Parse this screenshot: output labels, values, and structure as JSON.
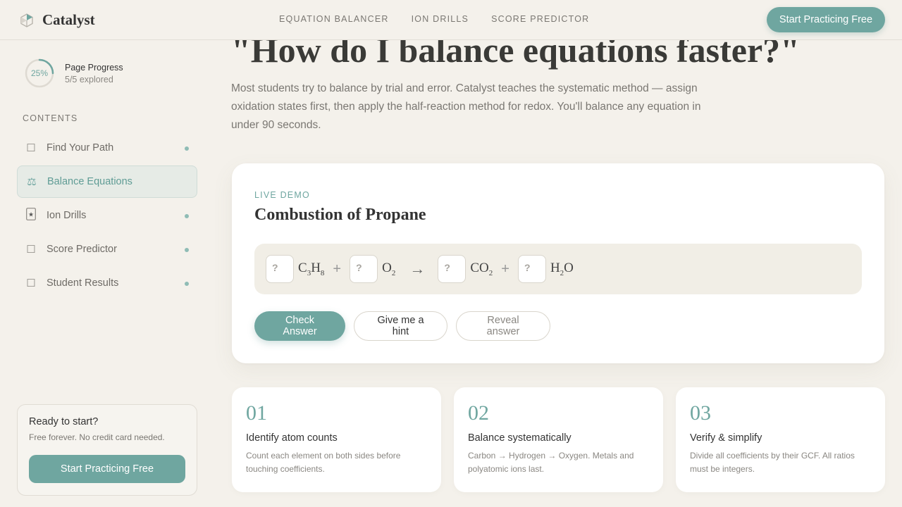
{
  "header": {
    "brand": "Catalyst",
    "nav": [
      "EQUATION BALANCER",
      "ION DRILLS",
      "SCORE PREDICTOR"
    ],
    "cta": "Start Practicing Free"
  },
  "sidebar": {
    "progress": {
      "percent": "25%",
      "value": 0.25,
      "title": "Page Progress",
      "subtitle": "5/5 explored"
    },
    "contents_label": "CONTENTS",
    "items": [
      {
        "label": "Find Your Path",
        "icon": "page-icon",
        "active": false
      },
      {
        "label": "Balance Equations",
        "icon": "scale-icon",
        "active": true
      },
      {
        "label": "Ion Drills",
        "icon": "star-card-icon",
        "active": false
      },
      {
        "label": "Score Predictor",
        "icon": "page-icon",
        "active": false
      },
      {
        "label": "Student Results",
        "icon": "page-icon",
        "active": false
      }
    ],
    "card": {
      "title": "Ready to start?",
      "subtitle": "Free forever. No credit card needed.",
      "button": "Start Practicing Free"
    }
  },
  "hero": {
    "title": "\"How do I balance equations faster?\"",
    "subtitle": "Most students try to balance by trial and error. Catalyst teaches the systematic method — assign oxidation states first, then apply the half-reaction method for redox. You'll balance any equation in under 90 seconds."
  },
  "demo": {
    "label": "LIVE DEMO",
    "title": "Combustion of Propane",
    "placeholder": "?",
    "plus": "+",
    "arrow": "→",
    "buttons": {
      "check": "Check Answer",
      "hint": "Give me a hint",
      "reveal": "Reveal answer"
    }
  },
  "steps": [
    {
      "num": "01",
      "title": "Identify atom counts",
      "desc": "Count each element on both sides before touching coefficients."
    },
    {
      "num": "02",
      "title": "Balance systematically",
      "desc": "Carbon → Hydrogen → Oxygen. Metals and polyatomic ions last."
    },
    {
      "num": "03",
      "title": "Verify & simplify",
      "desc": "Divide all coefficients by their GCF. All ratios must be integers."
    }
  ],
  "colors": {
    "accent": "#6fa6a0",
    "background": "#f4f1eb"
  }
}
